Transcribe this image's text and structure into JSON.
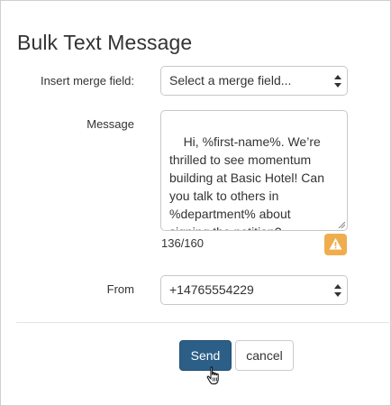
{
  "dialog": {
    "title": "Bulk Text Message"
  },
  "merge_field": {
    "label": "Insert merge field:",
    "value": "Select a merge field..."
  },
  "message": {
    "label": "Message",
    "text": "Hi, %first-name%. We’re\nthrilled to see momentum\nbuilding at Basic Hotel! Can\nyou talk to others in\n%department% about\nsigning the petition?",
    "counter": "136/160"
  },
  "from": {
    "label": "From",
    "value": "+14765554229"
  },
  "actions": {
    "send_label": "Send",
    "cancel_label": "cancel"
  },
  "colors": {
    "primary": "#2b5f87",
    "warning": "#f0ad4e"
  },
  "icons": {
    "warning": "warning-triangle-icon",
    "select": "select-arrows-icon",
    "cursor": "hand-pointer-icon"
  }
}
